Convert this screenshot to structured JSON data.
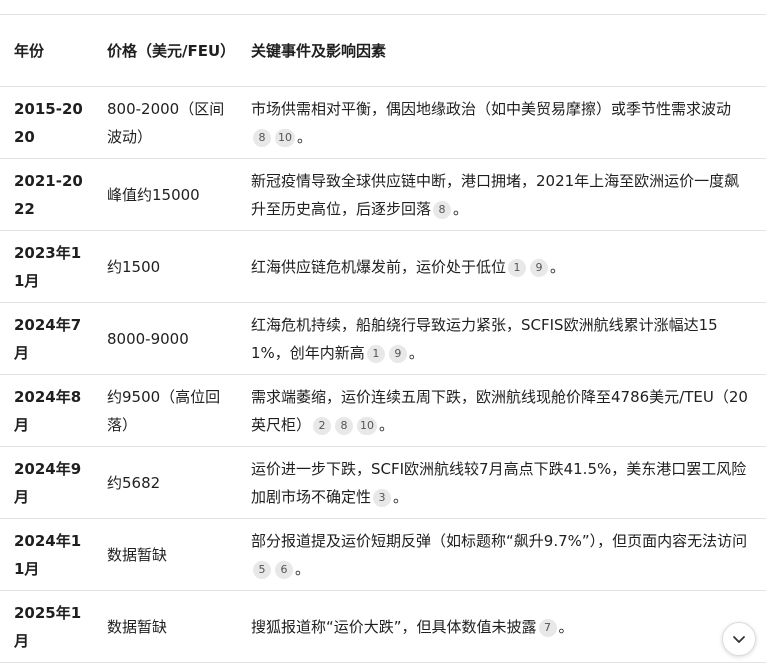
{
  "table": {
    "headers": {
      "year": "年份",
      "price": "价格（美元/FEU）",
      "event": "关键事件及影响因素"
    },
    "rows": [
      {
        "year": "2015-2020",
        "price": "800-2000（区间波动）",
        "event": "市场供需相对平衡，偶因地缘政治（如中美贸易摩擦）或季节性需求波动",
        "cites": [
          "8",
          "10"
        ],
        "end": "。"
      },
      {
        "year": "2021-2022",
        "price": "峰值约15000",
        "event": "新冠疫情导致全球供应链中断，港口拥堵，2021年上海至欧洲运价一度飙升至历史高位，后逐步回落",
        "cites": [
          "8"
        ],
        "end": "。"
      },
      {
        "year": "2023年11月",
        "price": "约1500",
        "event": "红海供应链危机爆发前，运价处于低位",
        "cites": [
          "1",
          "9"
        ],
        "end": "。"
      },
      {
        "year": "2024年7月",
        "price": "8000-9000",
        "event": "红海危机持续，船舶绕行导致运力紧张，SCFIS欧洲航线累计涨幅达151%，创年内新高",
        "cites": [
          "1",
          "9"
        ],
        "end": "。"
      },
      {
        "year": "2024年8月",
        "price": "约9500（高位回落）",
        "event": "需求端萎缩，运价连续五周下跌，欧洲航线现舱价降至4786美元/TEU（20英尺柜）",
        "cites": [
          "2",
          "8",
          "10"
        ],
        "end": "。"
      },
      {
        "year": "2024年9月",
        "price": "约5682",
        "event": "运价进一步下跌，SCFI欧洲航线较7月高点下跌41.5%，美东港口罢工风险加剧市场不确定性",
        "cites": [
          "3"
        ],
        "end": "。"
      },
      {
        "year": "2024年11月",
        "price": "数据暂缺",
        "event": "部分报道提及运价短期反弹（如标题称“飙升9.7%”），但页面内容无法访问",
        "cites": [
          "5",
          "6"
        ],
        "end": "。"
      },
      {
        "year": "2025年1月",
        "price": "数据暂缺",
        "event": "搜狐报道称“运价大跌”，但具体数值未披露",
        "cites": [
          "7"
        ],
        "end": "。"
      }
    ]
  },
  "icons": {
    "scroll_down": "chevron-down-icon"
  }
}
